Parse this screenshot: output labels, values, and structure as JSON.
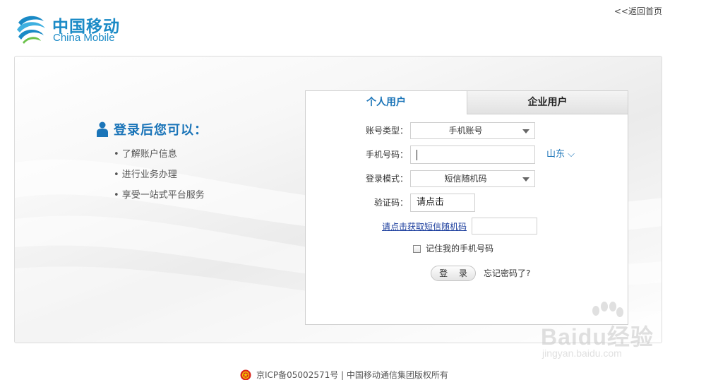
{
  "header": {
    "logo_cn": "中国移动",
    "logo_en": "China Mobile",
    "back_home": "<<返回首页"
  },
  "benefits": {
    "title": "登录后您可以：",
    "items": [
      "• 了解账户信息",
      "• 进行业务办理",
      "• 享受一站式平台服务"
    ]
  },
  "login": {
    "tabs": [
      {
        "label": "个人用户",
        "active": true
      },
      {
        "label": "企业用户",
        "active": false
      }
    ],
    "account_type": {
      "label": "账号类型：",
      "value": "手机账号"
    },
    "phone": {
      "label": "手机号码：",
      "value": "",
      "region": "山东 ⌵"
    },
    "login_mode": {
      "label": "登录模式：",
      "value": "短信随机码"
    },
    "captcha": {
      "label": "验证码：",
      "value": "请点击"
    },
    "sms": {
      "link": "请点击获取短信随机码",
      "value": ""
    },
    "remember": {
      "label": "记住我的手机号码",
      "checked": false
    },
    "submit_label": "登 录",
    "forgot_label": "忘记密码了?"
  },
  "footer": {
    "text": "京ICP备05002571号 | 中国移动通信集团版权所有"
  },
  "watermark": {
    "brand": "Baidu经验",
    "url": "jingyan.baidu.com"
  },
  "colors": {
    "brand_blue": "#1a8ac6",
    "title_blue": "#1a74b8",
    "link_blue": "#1d3f9e"
  }
}
